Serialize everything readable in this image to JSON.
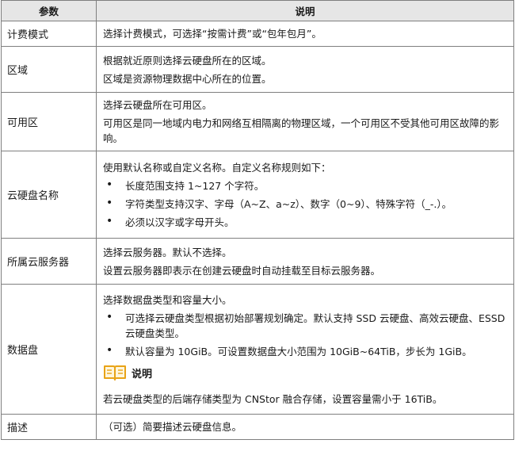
{
  "header": {
    "col1": "参数",
    "col2": "说明"
  },
  "rows": {
    "billing": {
      "name": "计费模式",
      "desc": "选择计费模式，可选择“按需计费”或“包年包月”。"
    },
    "region": {
      "name": "区域",
      "lines": [
        "根据就近原则选择云硬盘所在的区域。",
        "区域是资源物理数据中心所在的位置。"
      ]
    },
    "az": {
      "name": "可用区",
      "lines": [
        "选择云硬盘所在可用区。",
        "可用区是同一地域内电力和网络互相隔离的物理区域，一个可用区不受其他可用区故障的影响。"
      ]
    },
    "disk_name": {
      "name": "云硬盘名称",
      "intro": "使用默认名称或自定义名称。自定义名称规则如下：",
      "bullets": [
        "长度范围支持 1~127 个字符。",
        "字符类型支持汉字、字母（A~Z、a~z）、数字（0~9）、特殊字符（_-.）。",
        "必须以汉字或字母开头。"
      ]
    },
    "server": {
      "name": "所属云服务器",
      "lines": [
        "选择云服务器。默认不选择。",
        "设置云服务器即表示在创建云硬盘时自动挂载至目标云服务器。"
      ]
    },
    "data_disk": {
      "name": "数据盘",
      "intro": "选择数据盘类型和容量大小。",
      "bullets": [
        "可选择云硬盘类型根据初始部署规划确定。默认支持 SSD 云硬盘、高效云硬盘、ESSD 云硬盘类型。",
        "默认容量为 10GiB。可设置数据盘大小范围为 10GiB~64TiB，步长为 1GiB。"
      ],
      "note_label": "说明",
      "note_icon": "book-icon",
      "note_text": "若云硬盘类型的后端存储类型为 CNStor 融合存储，设置容量需小于 16TiB。"
    },
    "description": {
      "name": "描述",
      "desc": "（可选）简要描述云硬盘信息。"
    }
  },
  "colors": {
    "header_bg": "#e6e6e6",
    "border": "#7f7f7f",
    "note_icon": "#e8a317"
  }
}
